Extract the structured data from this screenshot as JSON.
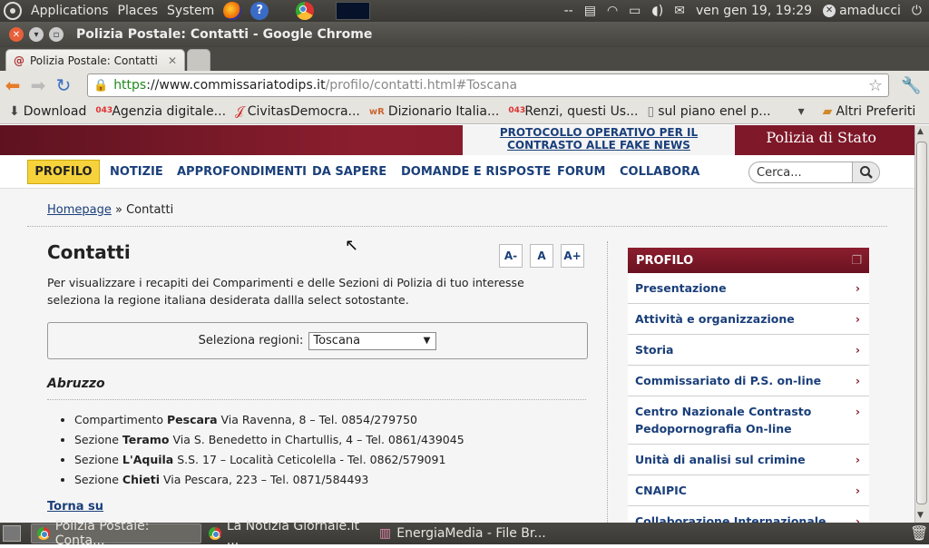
{
  "panel": {
    "applications": "Applications",
    "places": "Places",
    "system": "System",
    "status": "--",
    "datetime": "ven gen 19, 19:29",
    "user": "amaducci"
  },
  "window": {
    "title": "Polizia Postale: Contatti - Google Chrome"
  },
  "tabs": [
    {
      "label": "Polizia Postale: Contatti"
    }
  ],
  "address": {
    "scheme": "https",
    "host": "://www.commissariatodips.it",
    "path": "/profilo/contatti.html#Toscana"
  },
  "bookmarks": {
    "items": [
      {
        "label": "Download"
      },
      {
        "label": "Agenzia digitale..."
      },
      {
        "label": "CivitasDemocra..."
      },
      {
        "label": "Dizionario Italia..."
      },
      {
        "label": "Renzi, questi Us..."
      },
      {
        "label": "sul piano enel p..."
      }
    ],
    "overflow": "▾",
    "other": "Altri Preferiti"
  },
  "site": {
    "fake_news_link": "PROTOCOLLO OPERATIVO PER IL CONTRASTO ALLE FAKE NEWS",
    "brand": "Polizia di Stato",
    "nav": [
      "PROFILO",
      "NOTIZIE",
      "APPROFONDIMENTI",
      "DA SAPERE",
      "DOMANDE E RISPOSTE",
      "FORUM",
      "COLLABORA"
    ],
    "search_placeholder": "Cerca...",
    "breadcrumb_home": "Homepage",
    "breadcrumb_sep": " » ",
    "breadcrumb_current": "Contatti",
    "title": "Contatti",
    "font_buttons": [
      "A-",
      "A",
      "A+"
    ],
    "intro": "Per visualizzare i recapiti dei Comparimenti e delle Sezioni di Polizia di tuo interesse seleziona la regione italiana desiderata dallla select sotostante.",
    "select_label": "Seleziona regioni:",
    "select_value": "Toscana",
    "region": "Abruzzo",
    "contacts": [
      {
        "pre": "Compartimento ",
        "city": "Pescara",
        "post": " Via Ravenna, 8 – Tel. 0854/279750"
      },
      {
        "pre": "Sezione ",
        "city": "Teramo",
        "post": " Via S. Benedetto in Chartullis, 4 – Tel. 0861/439045"
      },
      {
        "pre": "Sezione ",
        "city": "L'Aquila",
        "post": " S.S. 17 – Località Ceticolella - Tel. 0862/579091"
      },
      {
        "pre": "Sezione ",
        "city": "Chieti",
        "post": " Via Pescara, 223 – Tel. 0871/584493"
      }
    ],
    "back_top": "Torna su",
    "sidebar_title": "PROFILO",
    "sidebar": [
      "Presentazione",
      "Attività e organizzazione",
      "Storia",
      "Commissariato di P.S. on-line",
      "Centro Nazionale Contrasto Pedopornografia On-line",
      "Unità di analisi sul crimine",
      "CNAIPIC",
      "Collaborazione Internazionale"
    ]
  },
  "taskbar": [
    {
      "label": "Polizia Postale: Conta..."
    },
    {
      "label": "La Notizia Giornale.it ..."
    },
    {
      "label": "EnergiaMedia - File Br..."
    }
  ],
  "colors": {
    "brand_red": "#8b1e2e",
    "link_blue": "#1a3f7a",
    "nav_active": "#f6d33c"
  }
}
